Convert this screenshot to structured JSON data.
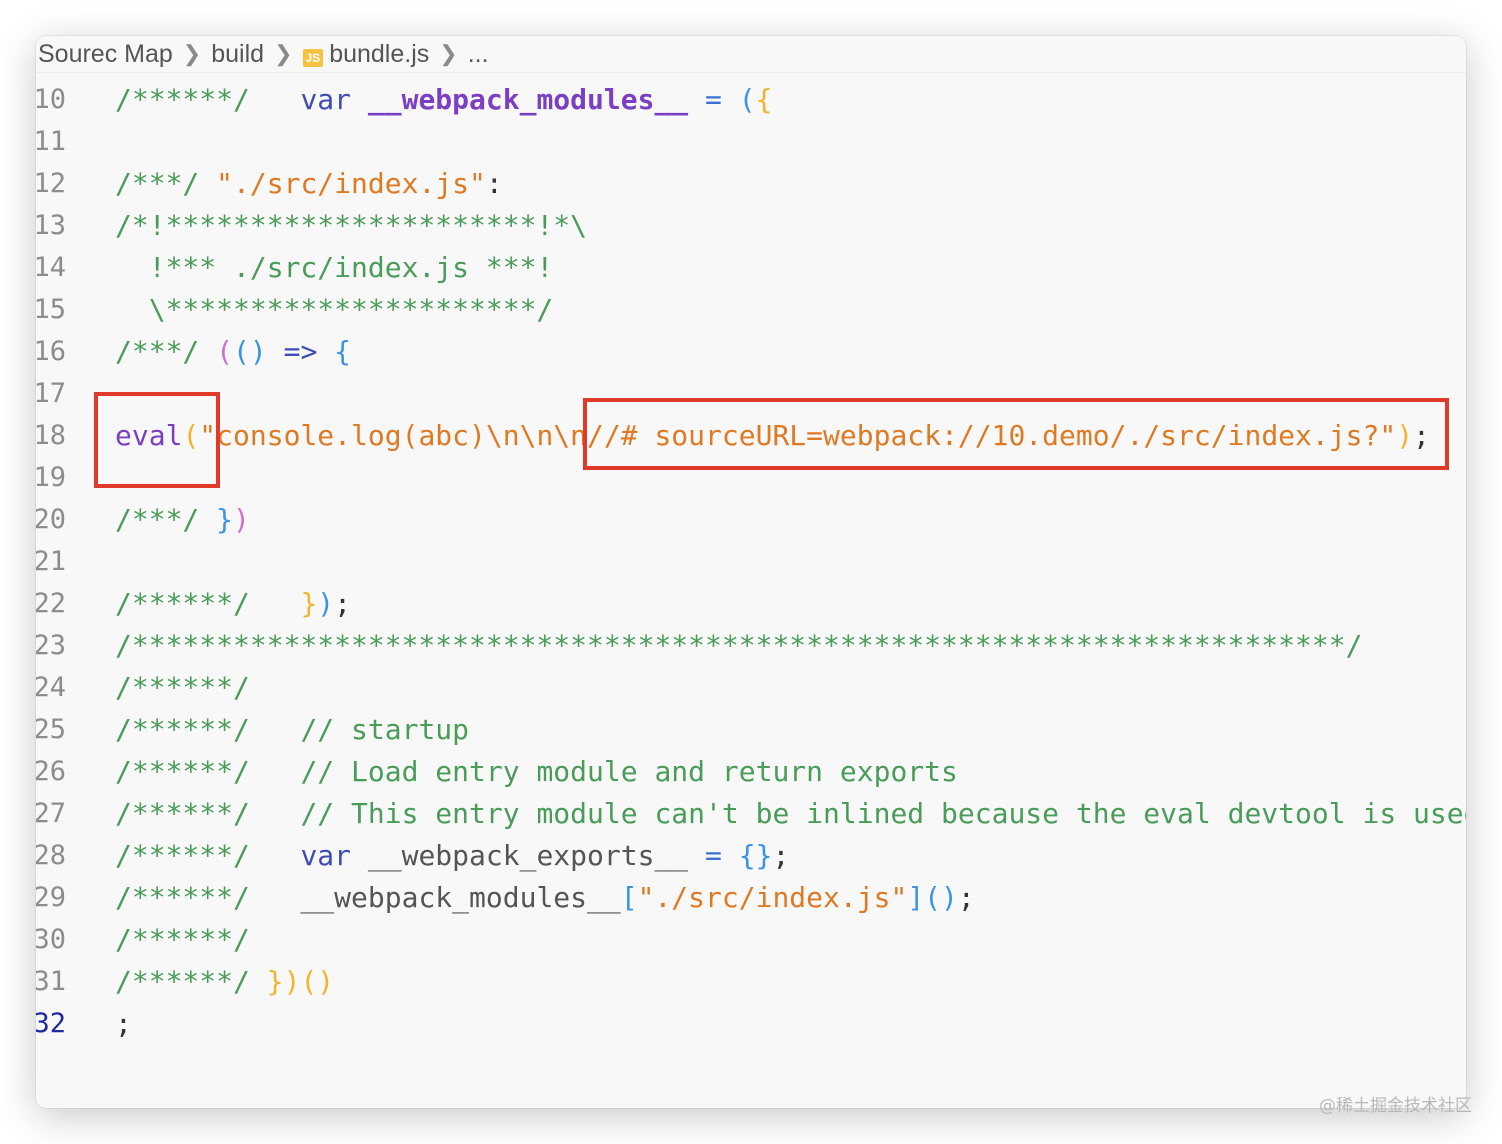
{
  "breadcrumb": {
    "items": [
      "Sourec Map",
      "build",
      "bundle.js",
      "..."
    ],
    "file_icon": "JS",
    "separator": ">"
  },
  "editor": {
    "active_line": 32,
    "lines": [
      {
        "n": "10",
        "tokens": [
          [
            "c",
            "/******/ "
          ],
          [
            "pl",
            "  "
          ],
          [
            "kw",
            "var "
          ],
          [
            "id",
            "__webpack_modules__"
          ],
          [
            "pl",
            " "
          ],
          [
            "op",
            "="
          ],
          [
            "pl",
            " "
          ],
          [
            "p3",
            "("
          ],
          [
            "p1",
            "{"
          ]
        ]
      },
      {
        "n": "11",
        "tokens": []
      },
      {
        "n": "12",
        "tokens": [
          [
            "c",
            "/***/ "
          ],
          [
            "s",
            "\"./src/index.js\""
          ],
          [
            "pl",
            ":"
          ]
        ]
      },
      {
        "n": "13",
        "tokens": [
          [
            "c",
            "/*!**********************!*\\"
          ]
        ]
      },
      {
        "n": "14",
        "tokens": [
          [
            "c",
            "  !*** ./src/index.js ***!"
          ]
        ]
      },
      {
        "n": "15",
        "tokens": [
          [
            "c",
            "  \\**********************/"
          ]
        ]
      },
      {
        "n": "16",
        "tokens": [
          [
            "c",
            "/***/ "
          ],
          [
            "p2",
            "("
          ],
          [
            "p3",
            "()"
          ],
          [
            "pl",
            " "
          ],
          [
            "kw",
            "=>"
          ],
          [
            "pl",
            " "
          ],
          [
            "p3",
            "{"
          ]
        ]
      },
      {
        "n": "17",
        "tokens": []
      },
      {
        "n": "18",
        "tokens": [
          [
            "fn",
            "eval"
          ],
          [
            "p1",
            "("
          ],
          [
            "s",
            "\"console.log(abc)\\n\\n\\n//# sourceURL=webpack://10.demo/./src/index.js?\""
          ],
          [
            "p1",
            ")"
          ],
          [
            "pl",
            ";"
          ]
        ]
      },
      {
        "n": "19",
        "tokens": []
      },
      {
        "n": "20",
        "tokens": [
          [
            "c",
            "/***/ "
          ],
          [
            "p3",
            "}"
          ],
          [
            "p2",
            ")"
          ]
        ]
      },
      {
        "n": "21",
        "tokens": []
      },
      {
        "n": "22",
        "tokens": [
          [
            "c",
            "/******/ "
          ],
          [
            "pl",
            "  "
          ],
          [
            "p1",
            "}"
          ],
          [
            "p3",
            ")"
          ],
          [
            "pl",
            ";"
          ]
        ]
      },
      {
        "n": "23",
        "tokens": [
          [
            "c",
            "/************************************************************************/"
          ]
        ]
      },
      {
        "n": "24",
        "tokens": [
          [
            "c",
            "/******/"
          ]
        ]
      },
      {
        "n": "25",
        "tokens": [
          [
            "c",
            "/******/ "
          ],
          [
            "pl",
            "  "
          ],
          [
            "c",
            "// startup"
          ]
        ]
      },
      {
        "n": "26",
        "tokens": [
          [
            "c",
            "/******/ "
          ],
          [
            "pl",
            "  "
          ],
          [
            "c",
            "// Load entry module and return exports"
          ]
        ]
      },
      {
        "n": "27",
        "tokens": [
          [
            "c",
            "/******/ "
          ],
          [
            "pl",
            "  "
          ],
          [
            "c",
            "// This entry module can't be inlined because the eval devtool is used"
          ]
        ]
      },
      {
        "n": "28",
        "tokens": [
          [
            "c",
            "/******/ "
          ],
          [
            "pl",
            "  "
          ],
          [
            "kw",
            "var "
          ],
          [
            "gr",
            "__webpack_exports__"
          ],
          [
            "pl",
            " "
          ],
          [
            "op",
            "="
          ],
          [
            "pl",
            " "
          ],
          [
            "p3",
            "{}"
          ],
          [
            "pl",
            ";"
          ]
        ]
      },
      {
        "n": "29",
        "tokens": [
          [
            "c",
            "/******/ "
          ],
          [
            "pl",
            "  "
          ],
          [
            "gr",
            "__webpack_modules__"
          ],
          [
            "p3",
            "["
          ],
          [
            "s",
            "\"./src/index.js\""
          ],
          [
            "p3",
            "]"
          ],
          [
            "p3",
            "()"
          ],
          [
            "pl",
            ";"
          ]
        ]
      },
      {
        "n": "30",
        "tokens": [
          [
            "c",
            "/******/"
          ]
        ]
      },
      {
        "n": "31",
        "tokens": [
          [
            "c",
            "/******/ "
          ],
          [
            "p1",
            "})"
          ],
          [
            "p1",
            "()"
          ]
        ]
      },
      {
        "n": "32",
        "tokens": [
          [
            "pl",
            ";"
          ]
        ]
      }
    ]
  },
  "annotations": {
    "highlight_color": "#e03a2b"
  },
  "watermark": "@稀土掘金技术社区"
}
